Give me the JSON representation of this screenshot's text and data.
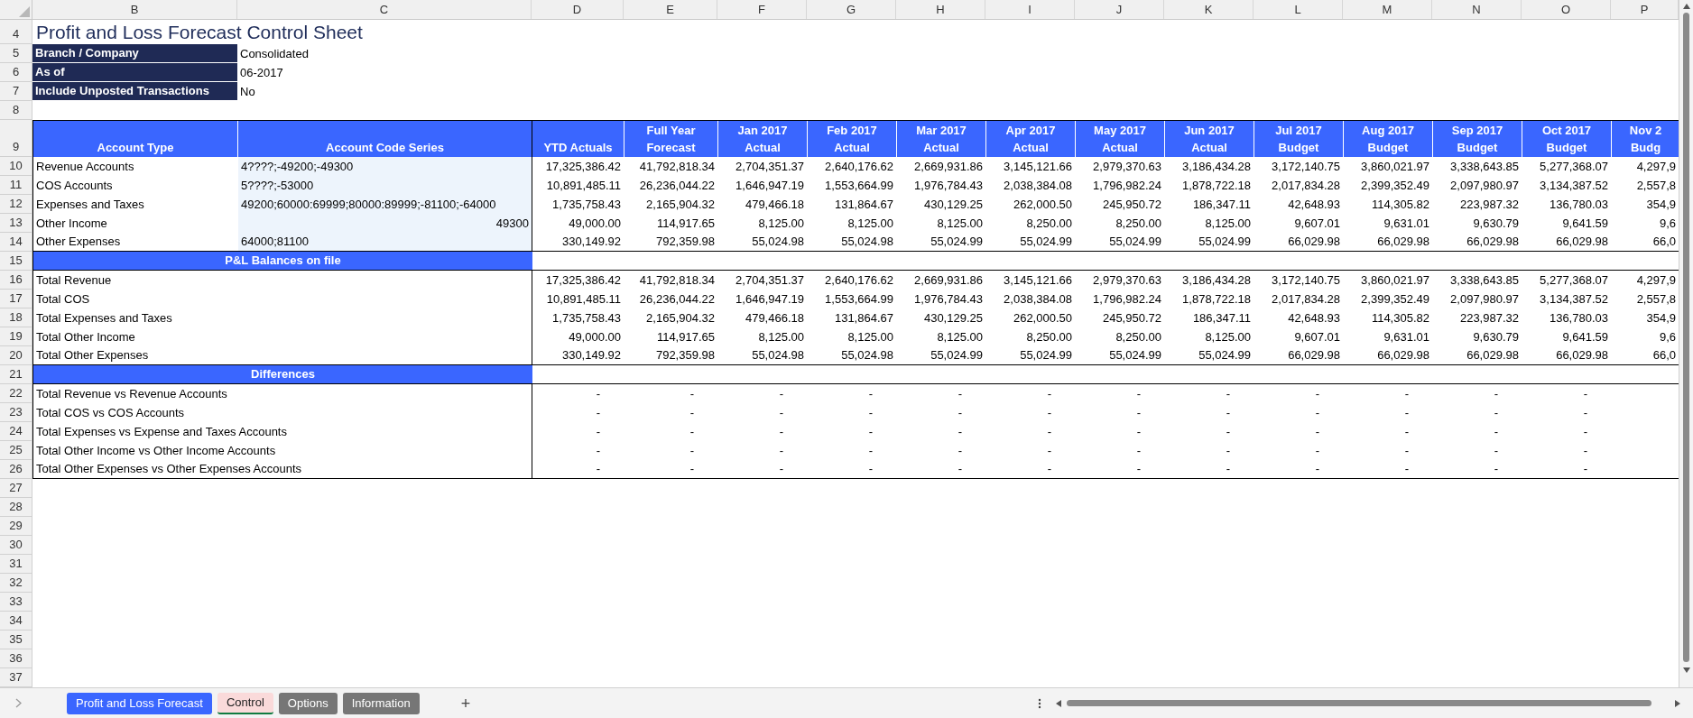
{
  "column_letters": [
    "B",
    "C",
    "D",
    "E",
    "F",
    "G",
    "H",
    "I",
    "J",
    "K",
    "L",
    "M",
    "N",
    "O",
    "P"
  ],
  "row_numbers": [
    "4",
    "5",
    "6",
    "7",
    "8",
    "9",
    "10",
    "11",
    "12",
    "13",
    "14",
    "15",
    "16",
    "17",
    "18",
    "19",
    "20",
    "21",
    "22",
    "23",
    "24",
    "25",
    "26",
    "27",
    "28",
    "29",
    "30",
    "31",
    "32",
    "33",
    "34",
    "35",
    "36",
    "37"
  ],
  "title": "Profit and Loss Forecast Control Sheet",
  "parameters": [
    {
      "label": "Branch / Company",
      "value": "Consolidated"
    },
    {
      "label": "As of",
      "value": "06-2017"
    },
    {
      "label": "Include Unposted Transactions",
      "value": "No"
    }
  ],
  "table": {
    "columns": [
      {
        "lines": [
          "Account Type"
        ]
      },
      {
        "lines": [
          "Account Code Series"
        ]
      },
      {
        "lines": [
          "YTD Actuals"
        ]
      },
      {
        "lines": [
          "Full Year",
          "Forecast"
        ]
      },
      {
        "lines": [
          "Jan 2017",
          "Actual"
        ]
      },
      {
        "lines": [
          "Feb 2017",
          "Actual"
        ]
      },
      {
        "lines": [
          "Mar 2017",
          "Actual"
        ]
      },
      {
        "lines": [
          "Apr 2017",
          "Actual"
        ]
      },
      {
        "lines": [
          "May 2017",
          "Actual"
        ]
      },
      {
        "lines": [
          "Jun 2017",
          "Actual"
        ]
      },
      {
        "lines": [
          "Jul 2017",
          "Budget"
        ]
      },
      {
        "lines": [
          "Aug 2017",
          "Budget"
        ]
      },
      {
        "lines": [
          "Sep 2017",
          "Budget"
        ]
      },
      {
        "lines": [
          "Oct 2017",
          "Budget"
        ]
      },
      {
        "lines": [
          "Nov 2",
          "Budg"
        ]
      }
    ],
    "account_rows": [
      {
        "type": "Revenue Accounts",
        "codes": "4????;-49200;-49300",
        "kind": "text",
        "values": [
          "17,325,386.42",
          "41,792,818.34",
          "2,704,351.37",
          "2,640,176.62",
          "2,669,931.86",
          "3,145,121.66",
          "2,979,370.63",
          "3,186,434.28",
          "3,172,140.75",
          "3,860,021.97",
          "3,338,643.85",
          "5,277,368.07",
          "4,297,9"
        ]
      },
      {
        "type": "COS Accounts",
        "codes": "5????;-53000",
        "kind": "text",
        "values": [
          "10,891,485.11",
          "26,236,044.22",
          "1,646,947.19",
          "1,553,664.99",
          "1,976,784.43",
          "2,038,384.08",
          "1,796,982.24",
          "1,878,722.18",
          "2,017,834.28",
          "2,399,352.49",
          "2,097,980.97",
          "3,134,387.52",
          "2,557,8"
        ]
      },
      {
        "type": "Expenses and Taxes",
        "codes": "49200;60000:69999;80000:89999;-81100;-64000",
        "kind": "text",
        "values": [
          "1,735,758.43",
          "2,165,904.32",
          "479,466.18",
          "131,864.67",
          "430,129.25",
          "262,000.50",
          "245,950.72",
          "186,347.11",
          "42,648.93",
          "114,305.82",
          "223,987.32",
          "136,780.03",
          "354,9"
        ]
      },
      {
        "type": "Other Income",
        "codes": "49300",
        "kind": "number",
        "values": [
          "49,000.00",
          "114,917.65",
          "8,125.00",
          "8,125.00",
          "8,125.00",
          "8,250.00",
          "8,250.00",
          "8,125.00",
          "9,607.01",
          "9,631.01",
          "9,630.79",
          "9,641.59",
          "9,6"
        ]
      },
      {
        "type": "Other Expenses",
        "codes": "64000;81100",
        "kind": "text",
        "values": [
          "330,149.92",
          "792,359.98",
          "55,024.98",
          "55,024.98",
          "55,024.99",
          "55,024.99",
          "55,024.99",
          "55,024.99",
          "66,029.98",
          "66,029.98",
          "66,029.98",
          "66,029.98",
          "66,0"
        ]
      }
    ],
    "balances_heading": "P&L Balances on file",
    "balance_rows": [
      {
        "label": "Total Revenue",
        "values": [
          "17,325,386.42",
          "41,792,818.34",
          "2,704,351.37",
          "2,640,176.62",
          "2,669,931.86",
          "3,145,121.66",
          "2,979,370.63",
          "3,186,434.28",
          "3,172,140.75",
          "3,860,021.97",
          "3,338,643.85",
          "5,277,368.07",
          "4,297,9"
        ]
      },
      {
        "label": "Total COS",
        "values": [
          "10,891,485.11",
          "26,236,044.22",
          "1,646,947.19",
          "1,553,664.99",
          "1,976,784.43",
          "2,038,384.08",
          "1,796,982.24",
          "1,878,722.18",
          "2,017,834.28",
          "2,399,352.49",
          "2,097,980.97",
          "3,134,387.52",
          "2,557,8"
        ]
      },
      {
        "label": "Total Expenses and Taxes",
        "values": [
          "1,735,758.43",
          "2,165,904.32",
          "479,466.18",
          "131,864.67",
          "430,129.25",
          "262,000.50",
          "245,950.72",
          "186,347.11",
          "42,648.93",
          "114,305.82",
          "223,987.32",
          "136,780.03",
          "354,9"
        ]
      },
      {
        "label": "Total Other Income",
        "values": [
          "49,000.00",
          "114,917.65",
          "8,125.00",
          "8,125.00",
          "8,125.00",
          "8,250.00",
          "8,250.00",
          "8,125.00",
          "9,607.01",
          "9,631.01",
          "9,630.79",
          "9,641.59",
          "9,6"
        ]
      },
      {
        "label": "Total Other Expenses",
        "values": [
          "330,149.92",
          "792,359.98",
          "55,024.98",
          "55,024.98",
          "55,024.99",
          "55,024.99",
          "55,024.99",
          "55,024.99",
          "66,029.98",
          "66,029.98",
          "66,029.98",
          "66,029.98",
          "66,0"
        ]
      }
    ],
    "differences_heading": "Differences",
    "difference_rows": [
      {
        "label": "Total Revenue vs Revenue Accounts",
        "values": [
          "-",
          "-",
          "-",
          "-",
          "-",
          "-",
          "-",
          "-",
          "-",
          "-",
          "-",
          "-"
        ]
      },
      {
        "label": "Total COS vs COS Accounts",
        "values": [
          "-",
          "-",
          "-",
          "-",
          "-",
          "-",
          "-",
          "-",
          "-",
          "-",
          "-",
          "-"
        ]
      },
      {
        "label": "Total Expenses vs Expense and Taxes Accounts",
        "values": [
          "-",
          "-",
          "-",
          "-",
          "-",
          "-",
          "-",
          "-",
          "-",
          "-",
          "-",
          "-"
        ]
      },
      {
        "label": "Total Other Income vs Other Income Accounts",
        "values": [
          "-",
          "-",
          "-",
          "-",
          "-",
          "-",
          "-",
          "-",
          "-",
          "-",
          "-",
          "-"
        ]
      },
      {
        "label": "Total Other Expenses vs Other Expenses Accounts",
        "values": [
          "-",
          "-",
          "-",
          "-",
          "-",
          "-",
          "-",
          "-",
          "-",
          "-",
          "-",
          "-"
        ]
      }
    ]
  },
  "sheet_tabs": [
    {
      "label": "Profit and Loss Forecast",
      "selected": false,
      "color": "#3a66ff"
    },
    {
      "label": "Control",
      "selected": true,
      "color": "#fadada"
    },
    {
      "label": "Options",
      "selected": false,
      "color": "#767676"
    },
    {
      "label": "Information",
      "selected": false,
      "color": "#767676"
    }
  ],
  "add_sheet": "+"
}
